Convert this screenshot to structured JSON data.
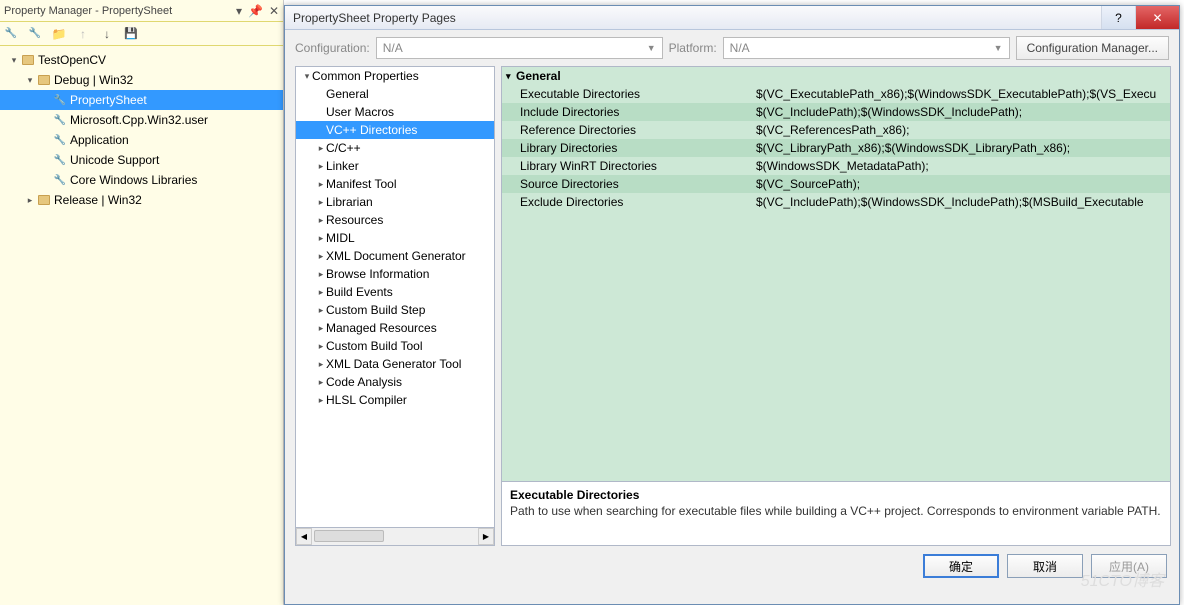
{
  "pm": {
    "title": "Property Manager - PropertySheet",
    "tree": [
      {
        "level": 0,
        "arrow": "▾",
        "icon": "folder",
        "label": "TestOpenCV"
      },
      {
        "level": 1,
        "arrow": "▾",
        "icon": "folder",
        "label": "Debug | Win32"
      },
      {
        "level": 2,
        "arrow": "",
        "icon": "wrench",
        "label": "PropertySheet",
        "selected": true
      },
      {
        "level": 2,
        "arrow": "",
        "icon": "wrench",
        "label": "Microsoft.Cpp.Win32.user"
      },
      {
        "level": 2,
        "arrow": "",
        "icon": "wrench",
        "label": "Application"
      },
      {
        "level": 2,
        "arrow": "",
        "icon": "wrench",
        "label": "Unicode Support"
      },
      {
        "level": 2,
        "arrow": "",
        "icon": "wrench",
        "label": "Core Windows Libraries"
      },
      {
        "level": 1,
        "arrow": "▸",
        "icon": "folder",
        "label": "Release | Win32"
      }
    ]
  },
  "dialog": {
    "title": "PropertySheet Property Pages",
    "config_label": "Configuration:",
    "config_value": "N/A",
    "platform_label": "Platform:",
    "platform_value": "N/A",
    "cfgmgr": "Configuration Manager...",
    "tree": [
      {
        "level": 0,
        "arrow": "▾",
        "label": "Common Properties"
      },
      {
        "level": 1,
        "arrow": "",
        "label": "General"
      },
      {
        "level": 1,
        "arrow": "",
        "label": "User Macros"
      },
      {
        "level": 1,
        "arrow": "",
        "label": "VC++ Directories",
        "selected": true
      },
      {
        "level": 1,
        "arrow": "▸",
        "label": "C/C++"
      },
      {
        "level": 1,
        "arrow": "▸",
        "label": "Linker"
      },
      {
        "level": 1,
        "arrow": "▸",
        "label": "Manifest Tool"
      },
      {
        "level": 1,
        "arrow": "▸",
        "label": "Librarian"
      },
      {
        "level": 1,
        "arrow": "▸",
        "label": "Resources"
      },
      {
        "level": 1,
        "arrow": "▸",
        "label": "MIDL"
      },
      {
        "level": 1,
        "arrow": "▸",
        "label": "XML Document Generator"
      },
      {
        "level": 1,
        "arrow": "▸",
        "label": "Browse Information"
      },
      {
        "level": 1,
        "arrow": "▸",
        "label": "Build Events"
      },
      {
        "level": 1,
        "arrow": "▸",
        "label": "Custom Build Step"
      },
      {
        "level": 1,
        "arrow": "▸",
        "label": "Managed Resources"
      },
      {
        "level": 1,
        "arrow": "▸",
        "label": "Custom Build Tool"
      },
      {
        "level": 1,
        "arrow": "▸",
        "label": "XML Data Generator Tool"
      },
      {
        "level": 1,
        "arrow": "▸",
        "label": "Code Analysis"
      },
      {
        "level": 1,
        "arrow": "▸",
        "label": "HLSL Compiler"
      }
    ],
    "grid": {
      "section": "General",
      "rows": [
        {
          "name": "Executable Directories",
          "value": "$(VC_ExecutablePath_x86);$(WindowsSDK_ExecutablePath);$(VS_Execu",
          "alt": false
        },
        {
          "name": "Include Directories",
          "value": "$(VC_IncludePath);$(WindowsSDK_IncludePath);",
          "alt": true
        },
        {
          "name": "Reference Directories",
          "value": "$(VC_ReferencesPath_x86);",
          "alt": false
        },
        {
          "name": "Library Directories",
          "value": "$(VC_LibraryPath_x86);$(WindowsSDK_LibraryPath_x86);",
          "alt": true
        },
        {
          "name": "Library WinRT Directories",
          "value": "$(WindowsSDK_MetadataPath);",
          "alt": false
        },
        {
          "name": "Source Directories",
          "value": "$(VC_SourcePath);",
          "alt": true
        },
        {
          "name": "Exclude Directories",
          "value": "$(VC_IncludePath);$(WindowsSDK_IncludePath);$(MSBuild_Executable",
          "alt": false
        }
      ]
    },
    "desc": {
      "title": "Executable Directories",
      "text": "Path to use when searching for executable files while building a VC++ project.  Corresponds to environment variable PATH."
    },
    "buttons": {
      "ok": "确定",
      "cancel": "取消",
      "apply": "应用(A)"
    }
  }
}
